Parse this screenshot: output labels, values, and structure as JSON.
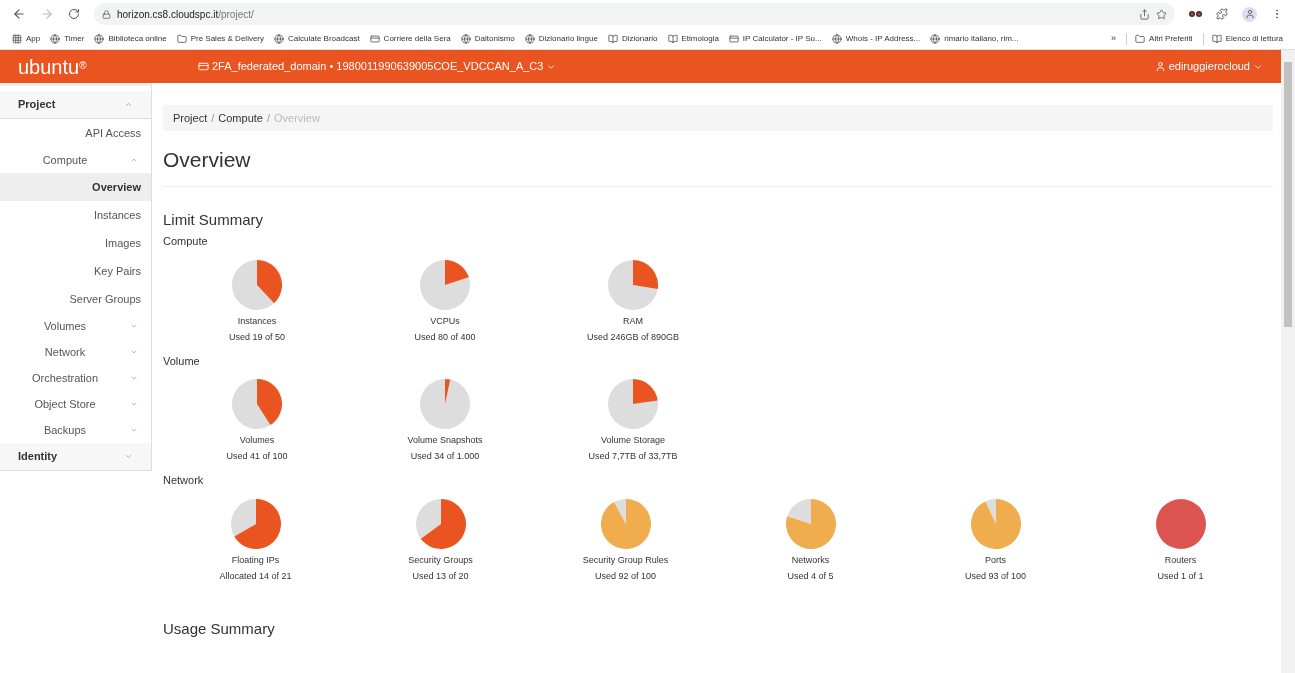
{
  "browser": {
    "url_host": "horizon.cs8.cloudspc.it",
    "url_path": "/project/",
    "bookmarks": [
      "App",
      "Timer",
      "Biblioteca online",
      "Pre Sales & Delivery",
      "Calculate Broadcast",
      "Corriere della Sera",
      "Daltonismo",
      "Dizionario lingue",
      "Dizionario",
      "Etimologia",
      "IP Calculator - IP Su...",
      "Whois - IP Address...",
      "rimario italiano, rim..."
    ],
    "overflow": "»",
    "other_bookmarks": [
      "Altri Preferiti",
      "Elenco di lettura"
    ]
  },
  "header": {
    "logo": "ubuntu",
    "logo_mark": "®",
    "project": "2FA_federated_domain • 1980011990639005COE_VDCCAN_A_C3",
    "user": "ediruggierocloud"
  },
  "sidebar": [
    {
      "label": "Project",
      "kind": "panel",
      "expanded": true,
      "children": [
        {
          "label": "API Access",
          "kind": "link",
          "selected": false
        },
        {
          "label": "Compute",
          "kind": "group",
          "expanded": true,
          "children": [
            {
              "label": "Overview",
              "kind": "link",
              "selected": true
            },
            {
              "label": "Instances",
              "kind": "link",
              "selected": false
            },
            {
              "label": "Images",
              "kind": "link",
              "selected": false
            },
            {
              "label": "Key Pairs",
              "kind": "link",
              "selected": false
            },
            {
              "label": "Server Groups",
              "kind": "link",
              "selected": false
            }
          ]
        },
        {
          "label": "Volumes",
          "kind": "group",
          "expanded": false
        },
        {
          "label": "Network",
          "kind": "group",
          "expanded": false
        },
        {
          "label": "Orchestration",
          "kind": "group",
          "expanded": false
        },
        {
          "label": "Object Store",
          "kind": "group",
          "expanded": false
        },
        {
          "label": "Backups",
          "kind": "group",
          "expanded": false
        }
      ]
    },
    {
      "label": "Identity",
      "kind": "panel",
      "expanded": false
    }
  ],
  "breadcrumb": {
    "separator": "/",
    "items": [
      "Project",
      "Compute",
      "Overview"
    ]
  },
  "title": "Overview",
  "limit_summary": {
    "title": "Limit Summary",
    "sections": [
      {
        "title": "Compute",
        "pies": [
          {
            "label": "Instances",
            "usage": "Used 19 of 50",
            "color": "#e95420",
            "chart_data": {
              "type": "pie",
              "values": [
                38,
                62
              ]
            }
          },
          {
            "label": "VCPUs",
            "usage": "Used 80 of 400",
            "color": "#e95420",
            "chart_data": {
              "type": "pie",
              "values": [
                20,
                80
              ]
            }
          },
          {
            "label": "RAM",
            "usage": "Used 246GB of 890GB",
            "color": "#e95420",
            "chart_data": {
              "type": "pie",
              "values": [
                27.6,
                72.4
              ]
            }
          }
        ]
      },
      {
        "title": "Volume",
        "pies": [
          {
            "label": "Volumes",
            "usage": "Used 41 of 100",
            "color": "#e95420",
            "chart_data": {
              "type": "pie",
              "values": [
                41,
                59
              ]
            }
          },
          {
            "label": "Volume Snapshots",
            "usage": "Used 34 of 1.000",
            "color": "#e95420",
            "chart_data": {
              "type": "pie",
              "values": [
                3.4,
                96.6
              ]
            }
          },
          {
            "label": "Volume Storage",
            "usage": "Used 7,7TB of 33,7TB",
            "color": "#e95420",
            "chart_data": {
              "type": "pie",
              "values": [
                22.8,
                77.2
              ]
            }
          }
        ]
      },
      {
        "title": "Network",
        "pies": [
          {
            "label": "Floating IPs",
            "usage": "Allocated 14 of 21",
            "color": "#e95420",
            "chart_data": {
              "type": "pie",
              "values": [
                66.7,
                33.3
              ]
            }
          },
          {
            "label": "Security Groups",
            "usage": "Used 13 of 20",
            "color": "#e95420",
            "chart_data": {
              "type": "pie",
              "values": [
                65,
                35
              ]
            }
          },
          {
            "label": "Security Group Rules",
            "usage": "Used 92 of 100",
            "color": "#efad4d",
            "chart_data": {
              "type": "pie",
              "values": [
                92,
                8
              ]
            }
          },
          {
            "label": "Networks",
            "usage": "Used 4 of 5",
            "color": "#efad4d",
            "chart_data": {
              "type": "pie",
              "values": [
                80,
                20
              ]
            }
          },
          {
            "label": "Ports",
            "usage": "Used 93 of 100",
            "color": "#efad4d",
            "chart_data": {
              "type": "pie",
              "values": [
                93,
                7
              ]
            }
          },
          {
            "label": "Routers",
            "usage": "Used 1 of 1",
            "color": "#dc5450",
            "chart_data": {
              "type": "pie",
              "values": [
                1,
                0
              ]
            }
          }
        ]
      }
    ]
  },
  "usage_summary": {
    "title": "Usage Summary"
  }
}
